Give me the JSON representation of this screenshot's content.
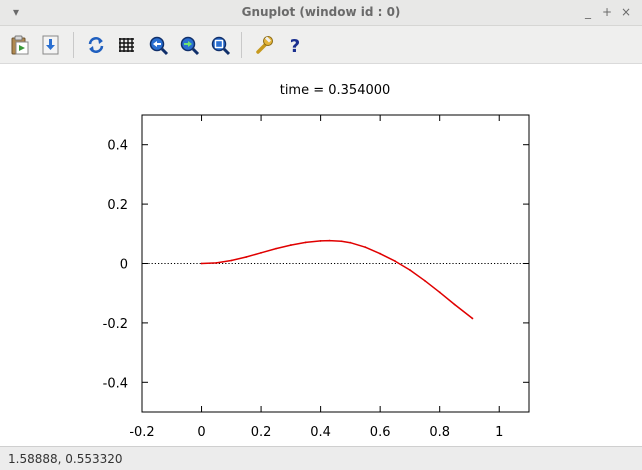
{
  "window": {
    "title": "Gnuplot (window id : 0)",
    "menu_glyph": "▾",
    "minimize_glyph": "_",
    "maximize_glyph": "+",
    "close_glyph": "×"
  },
  "toolbar": {
    "tools": [
      {
        "icon": "copy-to-clipboard-icon"
      },
      {
        "icon": "export-icon"
      },
      {
        "icon": "replot-icon"
      },
      {
        "icon": "grid-icon"
      },
      {
        "icon": "previous-zoom-icon"
      },
      {
        "icon": "next-zoom-icon"
      },
      {
        "icon": "autoscale-icon"
      },
      {
        "icon": "settings-wrench-icon"
      },
      {
        "icon": "help-icon"
      }
    ]
  },
  "status": {
    "coordinates": "1.58888,  0.553320"
  },
  "chart_data": {
    "type": "line",
    "title": "time = 0.354000",
    "xlim": [
      -0.2,
      1.1
    ],
    "ylim": [
      -0.5,
      0.5
    ],
    "xticks": [
      "-0.2",
      "0",
      "0.2",
      "0.4",
      "0.6",
      "0.8",
      "1"
    ],
    "yticks": [
      "0.4",
      "0.2",
      "0",
      "-0.2",
      "-0.4"
    ],
    "xtick_values": [
      -0.2,
      0,
      0.2,
      0.4,
      0.6,
      0.8,
      1.0
    ],
    "ytick_values": [
      0.4,
      0.2,
      0,
      -0.2,
      -0.4
    ],
    "zero_line": true,
    "grid": false,
    "series": [
      {
        "color": "#e00000",
        "x": [
          0.0,
          0.05,
          0.1,
          0.15,
          0.2,
          0.25,
          0.3,
          0.35,
          0.4,
          0.43,
          0.47,
          0.5,
          0.55,
          0.6,
          0.65,
          0.7,
          0.75,
          0.8,
          0.85,
          0.91
        ],
        "y": [
          0.0,
          0.002,
          0.01,
          0.022,
          0.036,
          0.05,
          0.062,
          0.071,
          0.076,
          0.077,
          0.075,
          0.07,
          0.055,
          0.033,
          0.008,
          -0.022,
          -0.058,
          -0.097,
          -0.138,
          -0.185
        ]
      }
    ]
  }
}
